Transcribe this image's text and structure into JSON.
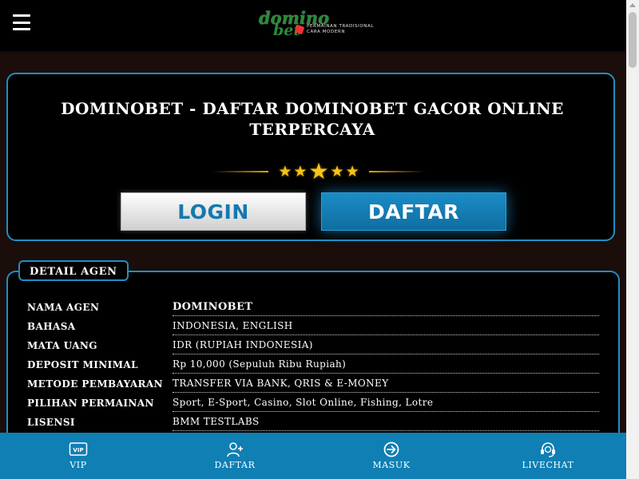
{
  "header": {
    "logo_word": "domino",
    "logo_word2": "bet",
    "logo_tagline_1": "PERMAINAN TRADISIONAL",
    "logo_tagline_2": "CARA MODERN"
  },
  "hero": {
    "title": "DOMINOBET - DAFTAR DOMINOBET GACOR ONLINE TERPERCAYA",
    "stars": "★★★★★",
    "login_label": "LOGIN",
    "daftar_label": "DAFTAR"
  },
  "detail": {
    "heading": "DETAIL AGEN",
    "rows": [
      {
        "label": "NAMA AGEN",
        "value": "DOMINOBET"
      },
      {
        "label": "BAHASA",
        "value": "INDONESIA, ENGLISH"
      },
      {
        "label": "MATA UANG",
        "value": "IDR (RUPIAH INDONESIA)"
      },
      {
        "label": "DEPOSIT MINIMAL",
        "value": "Rp 10,000 (Sepuluh Ribu Rupiah)"
      },
      {
        "label": "METODE PEMBAYARAN",
        "value": "TRANSFER VIA BANK, QRIS & E-MONEY"
      },
      {
        "label": "PILIHAN PERMAINAN",
        "value": "Sport, E-Sport, Casino, Slot Online, Fishing, Lotre"
      },
      {
        "label": "LISENSI",
        "value": "BMM TESTLABS"
      }
    ]
  },
  "bottom_nav": [
    {
      "label": "VIP",
      "icon": "vip-icon"
    },
    {
      "label": "DAFTAR",
      "icon": "user-add-icon"
    },
    {
      "label": "MASUK",
      "icon": "login-arrow-icon"
    },
    {
      "label": "LIVECHAT",
      "icon": "headset-icon"
    }
  ],
  "colors": {
    "accent": "#1f8fc4",
    "nav_bg": "#0f7fb4",
    "star": "#f5c518",
    "login_text": "#1479b0"
  }
}
